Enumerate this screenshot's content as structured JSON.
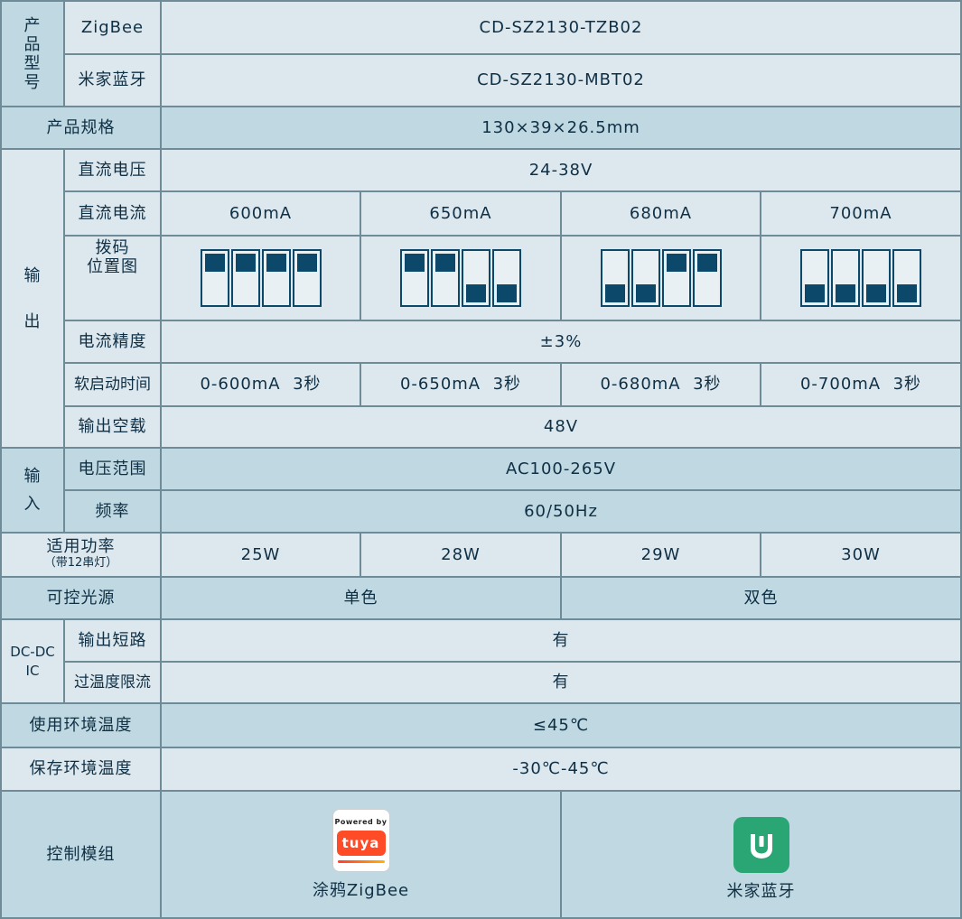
{
  "model": {
    "label": "产品型号",
    "zigbee_label": "ZigBee",
    "zigbee_value": "CD-SZ2130-TZB02",
    "bt_label": "米家蓝牙",
    "bt_value": "CD-SZ2130-MBT02"
  },
  "spec": {
    "label": "产品规格",
    "value": "130×39×26.5mm"
  },
  "output": {
    "group_label_1": "输",
    "group_label_2": "出",
    "dc_voltage": {
      "label": "直流电压",
      "value": "24-38V"
    },
    "dc_current": {
      "label": "直流电流",
      "values": [
        "600mA",
        "650mA",
        "680mA",
        "700mA"
      ]
    },
    "dip": {
      "label_line1": "拨码",
      "label_line2": "位置图",
      "patterns": [
        [
          "up",
          "up",
          "up",
          "up"
        ],
        [
          "up",
          "up",
          "down",
          "down"
        ],
        [
          "down",
          "down",
          "up",
          "up"
        ],
        [
          "down",
          "down",
          "down",
          "down"
        ]
      ]
    },
    "precision": {
      "label": "电流精度",
      "value": "±3%"
    },
    "soft_start": {
      "label": "软启动时间",
      "values": [
        "0-600mA  3秒",
        "0-650mA  3秒",
        "0-680mA  3秒",
        "0-700mA  3秒"
      ]
    },
    "no_load": {
      "label": "输出空载",
      "value": "48V"
    }
  },
  "input": {
    "group_label_1": "输",
    "group_label_2": "入",
    "voltage_range": {
      "label": "电压范围",
      "value": "AC100-265V"
    },
    "frequency": {
      "label": "频率",
      "value": "60/50Hz"
    }
  },
  "power": {
    "label_line1": "适用功率",
    "label_line2": "（带12串灯）",
    "values": [
      "25W",
      "28W",
      "29W",
      "30W"
    ]
  },
  "light_source": {
    "label": "可控光源",
    "values": [
      "单色",
      "双色"
    ]
  },
  "dcdc": {
    "label_line1": "DC-DC",
    "label_line2": "IC",
    "short_circuit": {
      "label": "输出短路",
      "value": "有"
    },
    "over_temp": {
      "label": "过温度限流",
      "value": "有"
    }
  },
  "env_temp": {
    "label": "使用环境温度",
    "value": "≤45℃"
  },
  "storage_temp": {
    "label": "保存环境温度",
    "value": "-30℃-45℃"
  },
  "control": {
    "label": "控制模组",
    "tuya": {
      "powered": "Powered by",
      "brand": "tuya",
      "caption": "涂鸦ZigBee"
    },
    "mijia": {
      "caption": "米家蓝牙"
    }
  },
  "colors": {
    "border": "#6f8b98",
    "light_cell": "#dce8ee",
    "dark_cell": "#bfd8e1",
    "dip_switch": "#0b4869",
    "tuya": "#ff4b26",
    "mijia": "#2aa574"
  }
}
